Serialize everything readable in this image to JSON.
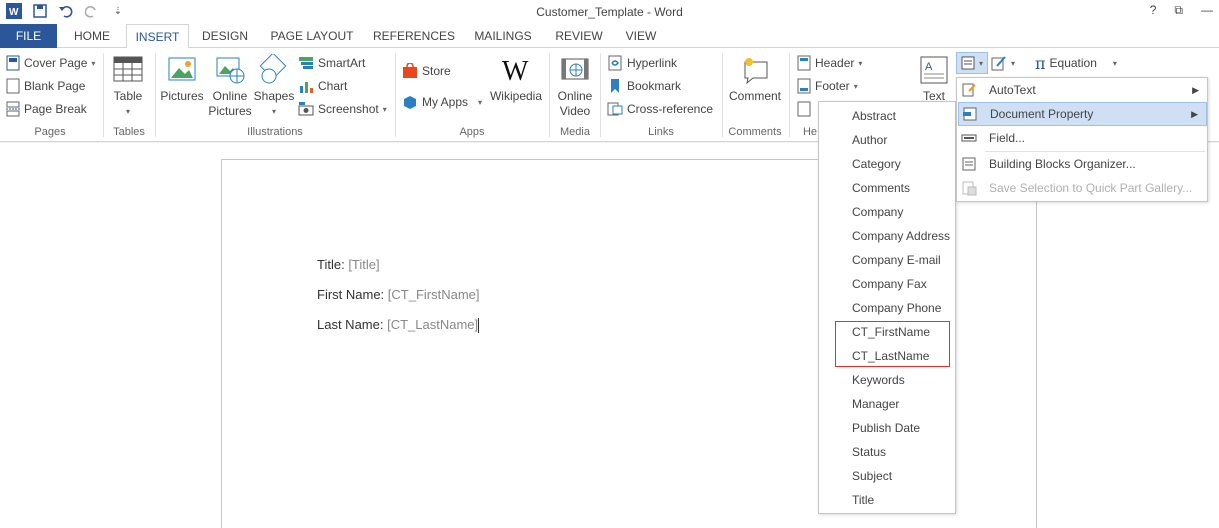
{
  "window": {
    "title": "Customer_Template - Word",
    "help": "?",
    "restore": "⧉",
    "minimize": "—"
  },
  "tabs": [
    {
      "label": "FILE"
    },
    {
      "label": "HOME"
    },
    {
      "label": "INSERT"
    },
    {
      "label": "DESIGN"
    },
    {
      "label": "PAGE LAYOUT"
    },
    {
      "label": "REFERENCES"
    },
    {
      "label": "MAILINGS"
    },
    {
      "label": "REVIEW"
    },
    {
      "label": "VIEW"
    }
  ],
  "ribbon": {
    "pages": {
      "cover_page": "Cover Page",
      "blank_page": "Blank Page",
      "page_break": "Page Break",
      "label": "Pages"
    },
    "tables": {
      "table": "Table",
      "label": "Tables"
    },
    "illustrations": {
      "pictures": "Pictures",
      "online_pictures_1": "Online",
      "online_pictures_2": "Pictures",
      "shapes": "Shapes",
      "smartart": "SmartArt",
      "chart": "Chart",
      "screenshot": "Screenshot",
      "label": "Illustrations"
    },
    "apps": {
      "store": "Store",
      "my_apps": "My Apps",
      "wikipedia": "Wikipedia",
      "label": "Apps"
    },
    "media": {
      "online_video_1": "Online",
      "online_video_2": "Video",
      "label": "Media"
    },
    "links": {
      "hyperlink": "Hyperlink",
      "bookmark": "Bookmark",
      "cross_reference": "Cross-reference",
      "label": "Links"
    },
    "comments": {
      "comment": "Comment",
      "label": "Comments"
    },
    "header_footer": {
      "header": "Header",
      "footer": "Footer",
      "label": "He"
    },
    "text": {
      "text": "Text"
    },
    "symbols": {
      "equation": "Equation"
    }
  },
  "document": {
    "lines": [
      {
        "label": "Title: ",
        "field": "[Title]"
      },
      {
        "label": "First Name: ",
        "field": "[CT_FirstName]"
      },
      {
        "label": "Last Name: ",
        "field": "[CT_LastName]"
      }
    ]
  },
  "property_list": {
    "items": [
      "Abstract",
      "Author",
      "Category",
      "Comments",
      "Company",
      "Company Address",
      "Company E-mail",
      "Company Fax",
      "Company Phone",
      "CT_FirstName",
      "CT_LastName",
      "Keywords",
      "Manager",
      "Publish Date",
      "Status",
      "Subject",
      "Title"
    ]
  },
  "quick_parts_menu": {
    "autotext": "AutoText",
    "document_property": "Document Property",
    "field": "Field...",
    "building_blocks": "Building Blocks Organizer...",
    "save_selection": "Save Selection to Quick Part Gallery..."
  },
  "colors": {
    "accent": "#2b579a",
    "highlight": "#cfe0f4",
    "red_box": "#e03030"
  }
}
